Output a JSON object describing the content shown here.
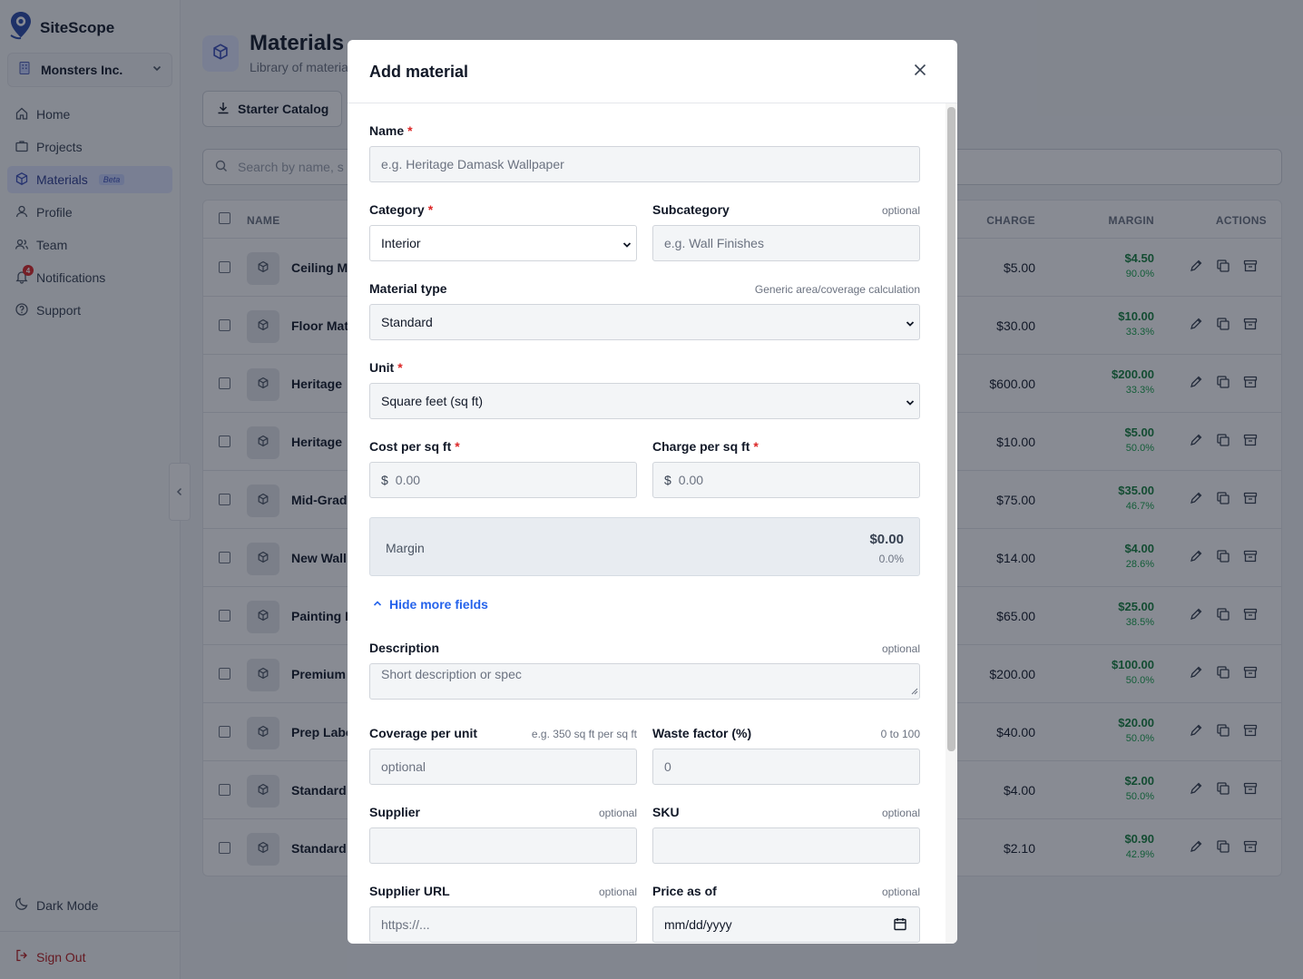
{
  "brand": {
    "name": "SiteScope"
  },
  "org": {
    "name": "Monsters Inc."
  },
  "nav": {
    "home": "Home",
    "projects": "Projects",
    "materials": "Materials",
    "beta": "Beta",
    "profile": "Profile",
    "team": "Team",
    "notifications": "Notifications",
    "notifications_count": "4",
    "support": "Support"
  },
  "footer": {
    "dark_mode": "Dark Mode",
    "sign_out": "Sign Out"
  },
  "page": {
    "title": "Materials",
    "subtitle": "Library of materials with cost and charge per unit, for quantity takeoffs using SiteScope measurements",
    "starter_catalog": "Starter Catalog",
    "search_placeholder": "Search by name, s"
  },
  "table": {
    "headers": {
      "name": "NAME",
      "charge": "CHARGE",
      "margin": "MARGIN",
      "actions": "ACTIONS"
    },
    "rows": [
      {
        "name": "Ceiling M",
        "charge": "$5.00",
        "margin": "$4.50",
        "pct": "90.0%"
      },
      {
        "name": "Floor Mat",
        "charge": "$30.00",
        "margin": "$10.00",
        "pct": "33.3%"
      },
      {
        "name": "Heritage",
        "charge": "$600.00",
        "margin": "$200.00",
        "pct": "33.3%"
      },
      {
        "name": "Heritage",
        "charge": "$10.00",
        "margin": "$5.00",
        "pct": "50.0%"
      },
      {
        "name": "Mid-Grad",
        "charge": "$75.00",
        "margin": "$35.00",
        "pct": "46.7%"
      },
      {
        "name": "New Wall",
        "charge": "$14.00",
        "margin": "$4.00",
        "pct": "28.6%"
      },
      {
        "name": "Painting L",
        "charge": "$65.00",
        "margin": "$25.00",
        "pct": "38.5%"
      },
      {
        "name": "Premium",
        "charge": "$200.00",
        "margin": "$100.00",
        "pct": "50.0%"
      },
      {
        "name": "Prep Labo",
        "charge": "$40.00",
        "margin": "$20.00",
        "pct": "50.0%"
      },
      {
        "name": "Standard",
        "charge": "$4.00",
        "margin": "$2.00",
        "pct": "50.0%"
      },
      {
        "name": "Standard",
        "charge": "$2.10",
        "margin": "$0.90",
        "pct": "42.9%"
      }
    ]
  },
  "modal": {
    "title": "Add material",
    "required_mark": "*",
    "name": {
      "label": "Name",
      "placeholder": "e.g. Heritage Damask Wallpaper"
    },
    "category": {
      "label": "Category",
      "value": "Interior"
    },
    "subcategory": {
      "label": "Subcategory",
      "hint": "optional",
      "placeholder": "e.g. Wall Finishes"
    },
    "material_type": {
      "label": "Material type",
      "hint": "Generic area/coverage calculation",
      "value": "Standard"
    },
    "unit": {
      "label": "Unit",
      "value": "Square feet (sq ft)"
    },
    "cost": {
      "label": "Cost per sq ft",
      "currency": "$",
      "placeholder": "0.00"
    },
    "charge": {
      "label": "Charge per sq ft",
      "currency": "$",
      "placeholder": "0.00"
    },
    "margin": {
      "label": "Margin",
      "amount": "$0.00",
      "percent": "0.0%"
    },
    "toggle_label": "Hide more fields",
    "description": {
      "label": "Description",
      "hint": "optional",
      "placeholder": "Short description or spec"
    },
    "coverage": {
      "label": "Coverage per unit",
      "hint": "e.g. 350 sq ft per sq ft",
      "placeholder": "optional"
    },
    "waste": {
      "label": "Waste factor (%)",
      "hint": "0 to 100",
      "value": "0"
    },
    "supplier": {
      "label": "Supplier",
      "hint": "optional",
      "value": ""
    },
    "sku": {
      "label": "SKU",
      "hint": "optional",
      "value": ""
    },
    "supplier_url": {
      "label": "Supplier URL",
      "hint": "optional",
      "placeholder": "https://..."
    },
    "price_as_of": {
      "label": "Price as of",
      "hint": "optional",
      "placeholder": "mm/dd/yyyy"
    }
  },
  "colors": {
    "accent": "#2563eb",
    "required": "#dc2626",
    "margin_green": "#15803d",
    "sign_out": "#b91c1c"
  }
}
